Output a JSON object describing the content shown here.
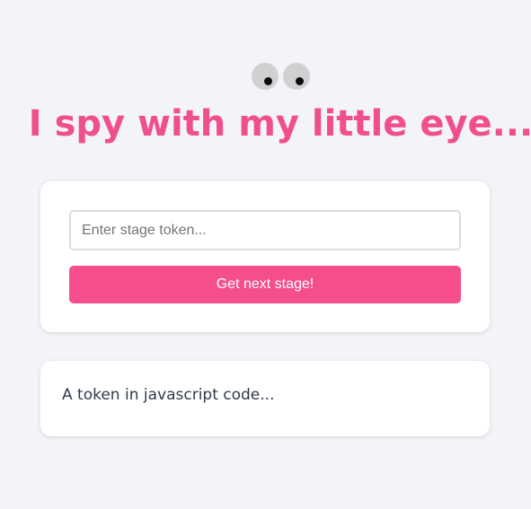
{
  "header": {
    "title": "I spy with my little eye...",
    "eye_color": "#d0d0d0",
    "pupil_color": "#0a0a0a"
  },
  "form": {
    "token_placeholder": "Enter stage token...",
    "token_value": "",
    "submit_label": "Get next stage!",
    "accent_color": "#f44f8c"
  },
  "hint": {
    "text": "A token in javascript code..."
  }
}
